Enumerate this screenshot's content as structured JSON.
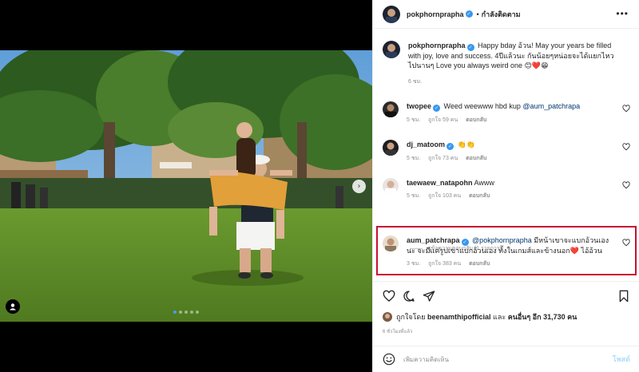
{
  "header": {
    "username": "pokphornprapha",
    "separator": "•",
    "follow_label": "กำลังติดตาม",
    "more_label": "•••"
  },
  "caption": {
    "username": "pokphornprapha",
    "text": "Happy bday อ้วน! May your years be filled with joy, love and success. 4ปีแล้วนะ กันน้อยๆหน่อยจะได้แยกไหวไปนานๆ Love you always weird one 😊❤️😁",
    "time": "6 ชม."
  },
  "comments": [
    {
      "username": "twopee",
      "text_before": "Weed weewww hbd kup ",
      "mention": "@aum_patchrapa",
      "text_after": "",
      "time": "5 ชม.",
      "likes": "ถูกใจ 59 คน",
      "reply": "ตอบกลับ"
    },
    {
      "username": "dj_matoom",
      "text_before": "👏👏",
      "mention": "",
      "text_after": "",
      "time": "5 ชม.",
      "likes": "ถูกใจ 73 คน",
      "reply": "ตอบกลับ"
    },
    {
      "username": "taewaew_natapohn",
      "text_before": "Awww",
      "mention": "",
      "text_after": "",
      "time": "5 ชม.",
      "likes": "ถูกใจ 103 คน",
      "reply": "ตอบกลับ"
    }
  ],
  "view_replies": "ดูข้อความตอบกลับ (1 รายการ)",
  "highlighted_comment": {
    "username": "aum_patchrapa",
    "mention": "@pokphornprapha",
    "text": " มีหน้าเขาจะแบกอ้วนเองนะ จะมีแค่รูปเขาแบกอ้วนเอง ทั้งในเกมส์และข้างนอก❤️ ไอ้อ้วน",
    "time": "3 ชม.",
    "likes": "ถูกใจ 383 คน",
    "reply": "ตอบกลับ"
  },
  "likes": {
    "prefix": "ถูกใจโดย ",
    "user": "beenamthipofficial",
    "middle": " และ ",
    "others": "คนอื่นๆ อีก 31,730 คน"
  },
  "timestamp": "6 ชั่วโมงที่แล้ว",
  "add_comment": {
    "placeholder": "เพิ่มความคิดเห็น",
    "post_label": "โพสต์"
  },
  "photo": {
    "carousel_count": 5,
    "carousel_active": 1,
    "next_arrow": "›"
  },
  "colors": {
    "accent_blue": "#3897f0",
    "highlight_red": "#c8102e",
    "muted_text": "#8e8e8e",
    "like_heart": "#ed4956"
  }
}
